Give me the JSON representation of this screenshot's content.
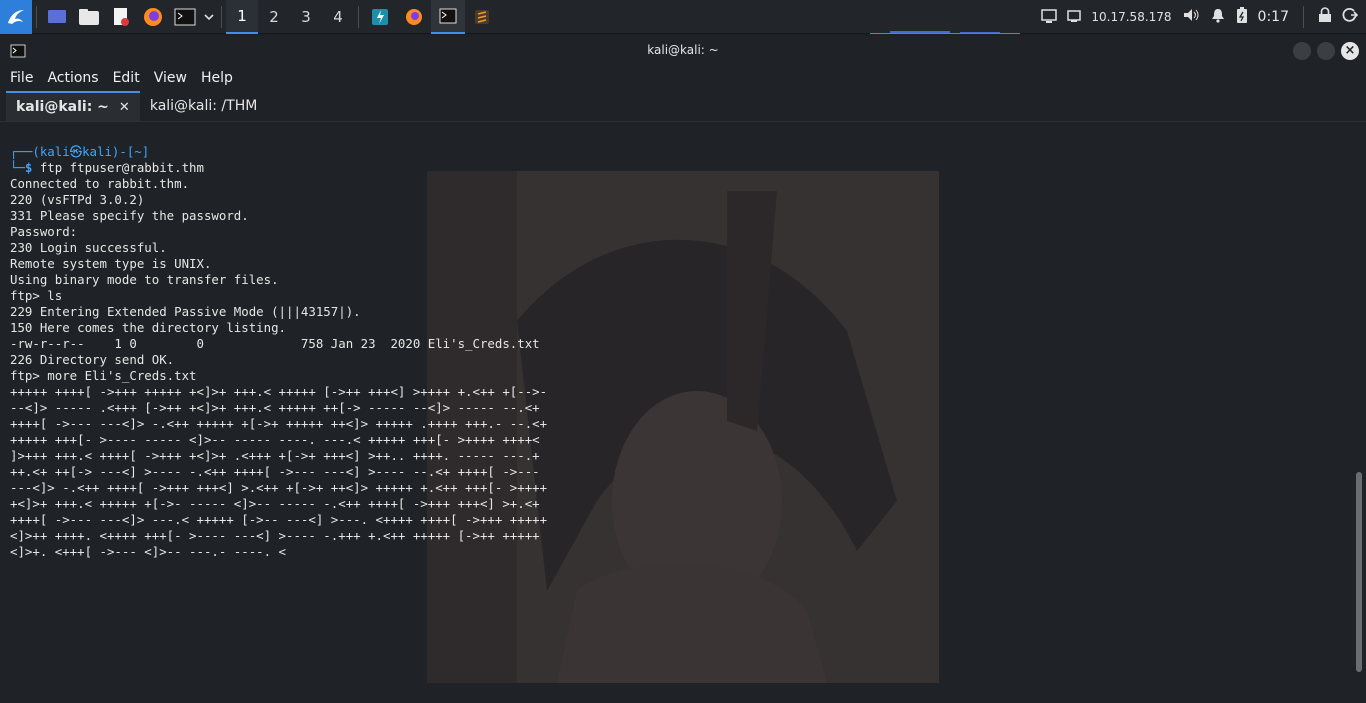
{
  "taskbar": {
    "workspaces": [
      "1",
      "2",
      "3",
      "4"
    ],
    "active_workspace": "1",
    "ip": "10.17.58.178",
    "clock": "0:17"
  },
  "window": {
    "title": "kali@kali: ~"
  },
  "menu": [
    "File",
    "Actions",
    "Edit",
    "View",
    "Help"
  ],
  "tabs": [
    {
      "label": "kali@kali: ~",
      "active": true
    },
    {
      "label": "kali@kali: /THM",
      "active": false
    }
  ],
  "terminal": {
    "prompt_user": "(kali㉿kali)-[~]",
    "command": "ftp ftpuser@rabbit.thm",
    "output": [
      "Connected to rabbit.thm.",
      "220 (vsFTPd 3.0.2)",
      "331 Please specify the password.",
      "Password:",
      "230 Login successful.",
      "Remote system type is UNIX.",
      "Using binary mode to transfer files.",
      "ftp> ls",
      "229 Entering Extended Passive Mode (|||43157|).",
      "150 Here comes the directory listing.",
      "-rw-r--r--    1 0        0             758 Jan 23  2020 Eli's_Creds.txt",
      "226 Directory send OK.",
      "ftp> more Eli's_Creds.txt",
      "+++++ ++++[ ->+++ +++++ +<]>+ +++.< +++++ [->++ +++<] >++++ +.<++ +[-->-",
      "--<]> ----- .<+++ [->++ +<]>+ +++.< +++++ ++[-> ----- --<]> ----- --.<+",
      "++++[ ->--- ---<]> -.<++ +++++ +[->+ +++++ ++<]> +++++ .++++ +++.- --.<+",
      "+++++ +++[- >---- ----- <]>-- ----- ----. ---.< +++++ +++[- >++++ ++++<",
      "]>+++ +++.< ++++[ ->+++ +<]>+ .<+++ +[->+ +++<] >++.. ++++. ----- ---.+",
      "++.<+ ++[-> ---<] >---- -.<++ ++++[ ->--- ---<] >---- --.<+ ++++[ ->---",
      "---<]> -.<++ ++++[ ->+++ +++<] >.<++ +[->+ ++<]> +++++ +.<++ +++[- >++++",
      "+<]>+ +++.< +++++ +[->- ----- <]>-- ----- -.<++ ++++[ ->+++ +++<] >+.<+",
      "++++[ ->--- ---<]> ---.< +++++ [->-- ---<] >---. <++++ ++++[ ->+++ +++++",
      "<]>++ ++++. <++++ +++[- >---- ---<] >---- -.+++ +.<++ +++++ [->++ +++++",
      "<]>+. <+++[ ->--- <]>-- ---.- ----. <"
    ]
  }
}
